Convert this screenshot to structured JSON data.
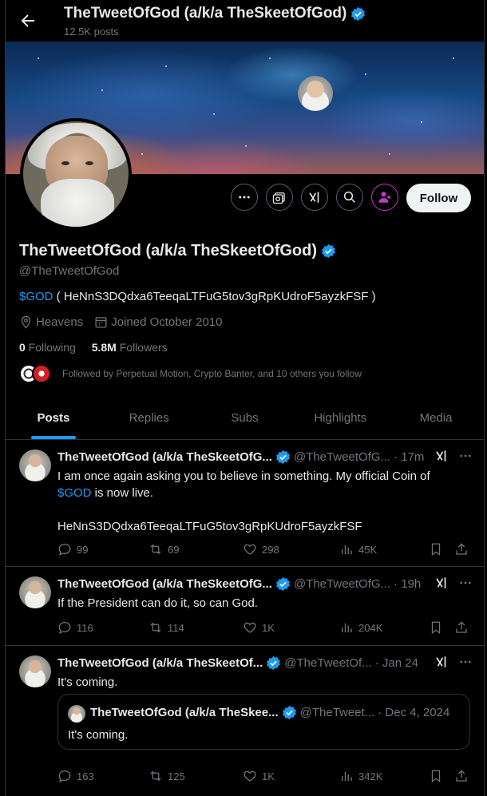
{
  "header": {
    "title": "TheTweetOfGod (a/k/a TheSkeetOfGod)",
    "posts_count": "12.5K posts"
  },
  "profile": {
    "name": "TheTweetOfGod (a/k/a TheSkeetOfGod)",
    "handle": "@TheTweetOfGod",
    "bio_link": "$GOD",
    "bio_rest": " ( HeNnS3DQdxa6TeeqaLTFuG5tov3gRpKUdroF5ayzkFSF )",
    "location": "Heavens",
    "joined": "Joined October 2010",
    "following_count": "0",
    "following_label": " Following",
    "followers_count": "5.8M",
    "followers_label": " Followers",
    "followed_by": "Followed by Perpetual Motion, Crypto Banter, and 10 others you follow",
    "follow_button": "Follow"
  },
  "tabs": [
    {
      "label": "Posts",
      "active": true
    },
    {
      "label": "Replies",
      "active": false
    },
    {
      "label": "Subs",
      "active": false
    },
    {
      "label": "Highlights",
      "active": false
    },
    {
      "label": "Media",
      "active": false
    }
  ],
  "tweets": [
    {
      "name": "TheTweetOfGod (a/k/a TheSkeetOfG...",
      "handle": "@TheTweetOfG...",
      "time": "· 17m",
      "text_line1": "I am once again asking you to believe in something.  My official Coin of",
      "text_link": "$GOD",
      "text_line2": " is now live.",
      "text_line3": "HeNnS3DQdxa6TeeqaLTFuG5tov3gRpKUdroF5ayzkFSF",
      "replies": "99",
      "reposts": "69",
      "likes": "298",
      "views": "45K"
    },
    {
      "name": "TheTweetOfGod (a/k/a TheSkeetOfG...",
      "handle": "@TheTweetOfG...",
      "time": "· 19h",
      "text": "If the President can do it, so can God.",
      "replies": "116",
      "reposts": "114",
      "likes": "1K",
      "views": "204K"
    },
    {
      "name": "TheTweetOfGod (a/k/a TheSkeetOf...",
      "handle": "@TheTweetOf...",
      "time": "· Jan 24",
      "text": "It's coming.",
      "quote": {
        "name": "TheTweetOfGod (a/k/a TheSkee...",
        "handle": "@TheTweet...",
        "time": "· Dec 4, 2024",
        "text": "It's coming."
      },
      "replies": "163",
      "reposts": "125",
      "likes": "1K",
      "views": "342K"
    }
  ],
  "colors": {
    "accent": "#1d9bf0",
    "verified": "#1d9bf0",
    "muted": "#71767b",
    "subscribe": "#c936cc"
  },
  "icons": [
    "back-arrow-icon",
    "verified-badge-icon",
    "more-icon",
    "grok-analyze-icon",
    "grok-icon",
    "search-icon",
    "subscribe-icon",
    "location-icon",
    "calendar-icon",
    "reply-icon",
    "repost-icon",
    "like-icon",
    "views-icon",
    "bookmark-icon",
    "share-icon"
  ]
}
